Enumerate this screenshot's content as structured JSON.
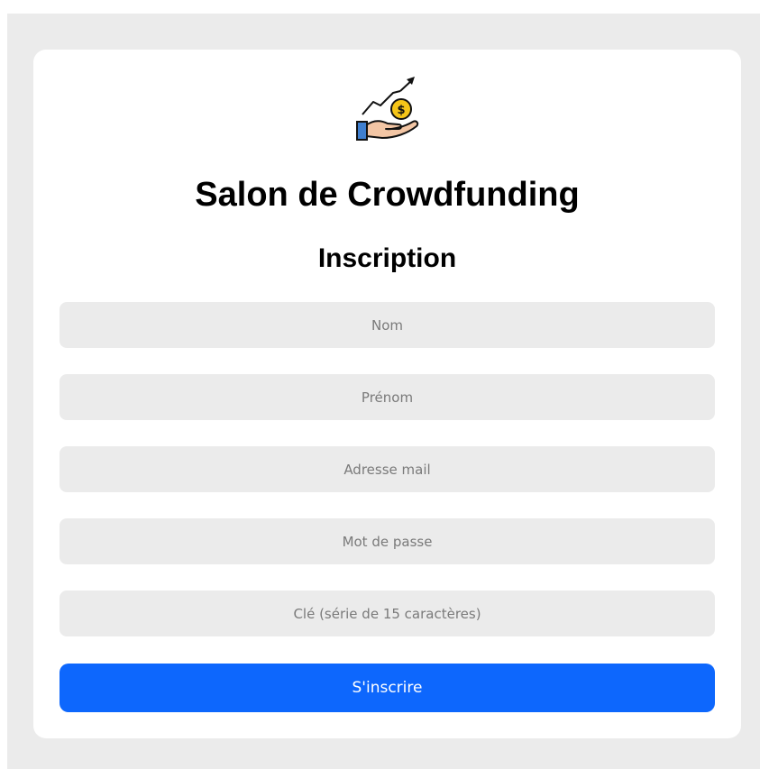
{
  "app": {
    "title": "Salon de Crowdfunding",
    "subtitle": "Inscription",
    "logo_icon": "hand-coin-growth-icon"
  },
  "form": {
    "fields": [
      {
        "name": "nom",
        "placeholder": "Nom",
        "value": ""
      },
      {
        "name": "prenom",
        "placeholder": "Prénom",
        "value": ""
      },
      {
        "name": "email",
        "placeholder": "Adresse mail",
        "value": ""
      },
      {
        "name": "password",
        "placeholder": "Mot de passe",
        "value": ""
      },
      {
        "name": "key",
        "placeholder": "Clé (série de 15 caractères)",
        "value": ""
      }
    ],
    "submit_label": "S'inscrire"
  },
  "colors": {
    "page_background": "#ebebeb",
    "card_background": "#ffffff",
    "field_background": "#ebebeb",
    "accent": "#0d67fd",
    "coin": "#f5c518",
    "hand": "#f3c6a5",
    "sleeve": "#3f7fcf"
  }
}
